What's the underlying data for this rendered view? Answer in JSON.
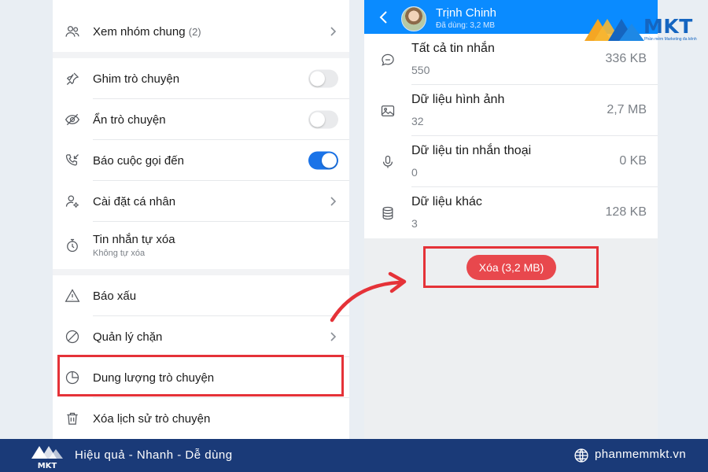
{
  "left_menu": {
    "common_groups": {
      "label": "Xem nhóm chung",
      "count": "(2)"
    },
    "pin_chat": {
      "label": "Ghim trò chuyện",
      "enabled": false
    },
    "hide_chat": {
      "label": "Ẩn trò chuyện",
      "enabled": false
    },
    "incoming_call": {
      "label": "Báo cuộc gọi đến",
      "enabled": true
    },
    "personal_settings": {
      "label": "Cài đặt cá nhân"
    },
    "auto_delete": {
      "label": "Tin nhắn tự xóa",
      "sub": "Không tự xóa"
    },
    "report": {
      "label": "Báo xấu"
    },
    "block_manage": {
      "label": "Quản lý chặn"
    },
    "chat_storage": {
      "label": "Dung lượng trò chuyện"
    },
    "clear_history": {
      "label": "Xóa lịch sử trò chuyện"
    }
  },
  "storage_screen": {
    "contact_name": "Trịnh Chinh",
    "usage": "Đã dùng: 3,2 MB",
    "rows": [
      {
        "title": "Tất cả tin nhắn",
        "count": "550",
        "size": "336 KB",
        "icon": "message-icon"
      },
      {
        "title": "Dữ liệu hình ảnh",
        "count": "32",
        "size": "2,7 MB",
        "icon": "image-icon"
      },
      {
        "title": "Dữ liệu tin nhắn thoại",
        "count": "0",
        "size": "0 KB",
        "icon": "microphone-icon"
      },
      {
        "title": "Dữ liệu khác",
        "count": "3",
        "size": "128 KB",
        "icon": "database-icon"
      }
    ],
    "delete_button": "Xóa (3,2 MB)"
  },
  "brand": {
    "logo_text": "MKT",
    "tagline": "Phần mềm Marketing đa kênh",
    "footer_logo_text": "MKT",
    "slogan": "Hiệu quả - Nhanh - Dễ dùng",
    "website": "phanmemmkt.vn"
  },
  "colors": {
    "accent_blue": "#0a8bff",
    "toggle_on": "#1a73e8",
    "highlight_red": "#e53238",
    "delete_red": "#e8484d",
    "footer_navy": "#1a3a78",
    "brand_orange": "#f5a623"
  }
}
